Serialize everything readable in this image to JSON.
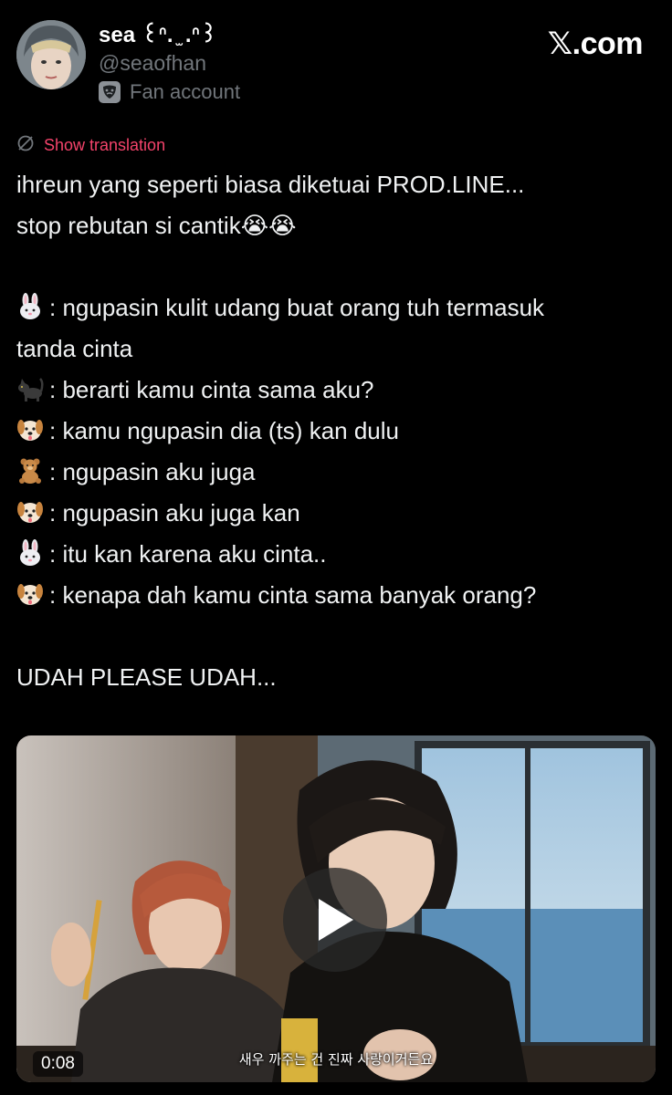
{
  "header": {
    "display_name": "sea ꒰ᐢ. ̫ .ᐢ꒱",
    "handle": "@seaofhan",
    "badge_label": "Fan account",
    "site_label": "𝕏.com"
  },
  "tweet": {
    "translation_label": "Show translation",
    "lines": [
      {
        "emoji": "",
        "text": "ihreun yang seperti biasa diketuai PROD.LINE..."
      },
      {
        "emoji": "",
        "text": "stop rebutan si cantik😭😭"
      },
      {
        "emoji": "",
        "text": ""
      },
      {
        "emoji": "rabbit-face",
        "text": ": ngupasin kulit udang buat orang tuh termasuk"
      },
      {
        "emoji": "",
        "text": "tanda cinta"
      },
      {
        "emoji": "black-cat",
        "text": ": berarti kamu cinta sama aku?"
      },
      {
        "emoji": "dog-face",
        "text": ": kamu ngupasin dia (ts) kan dulu"
      },
      {
        "emoji": "teddy-bear",
        "text": ": ngupasin aku juga"
      },
      {
        "emoji": "dog-face",
        "text": ": ngupasin aku juga kan"
      },
      {
        "emoji": "rabbit-face",
        "text": ": itu kan karena aku cinta.."
      },
      {
        "emoji": "dog-face",
        "text": ": kenapa dah kamu cinta sama banyak orang?"
      },
      {
        "emoji": "",
        "text": ""
      },
      {
        "emoji": "",
        "text": "UDAH PLEASE UDAH..."
      }
    ]
  },
  "media": {
    "duration": "0:08",
    "subtitle": "새우 까주는 건 진짜 사랑이거든요"
  },
  "colors": {
    "background": "#000000",
    "accent_pink": "#f4436b",
    "secondary_text": "#71767b"
  }
}
